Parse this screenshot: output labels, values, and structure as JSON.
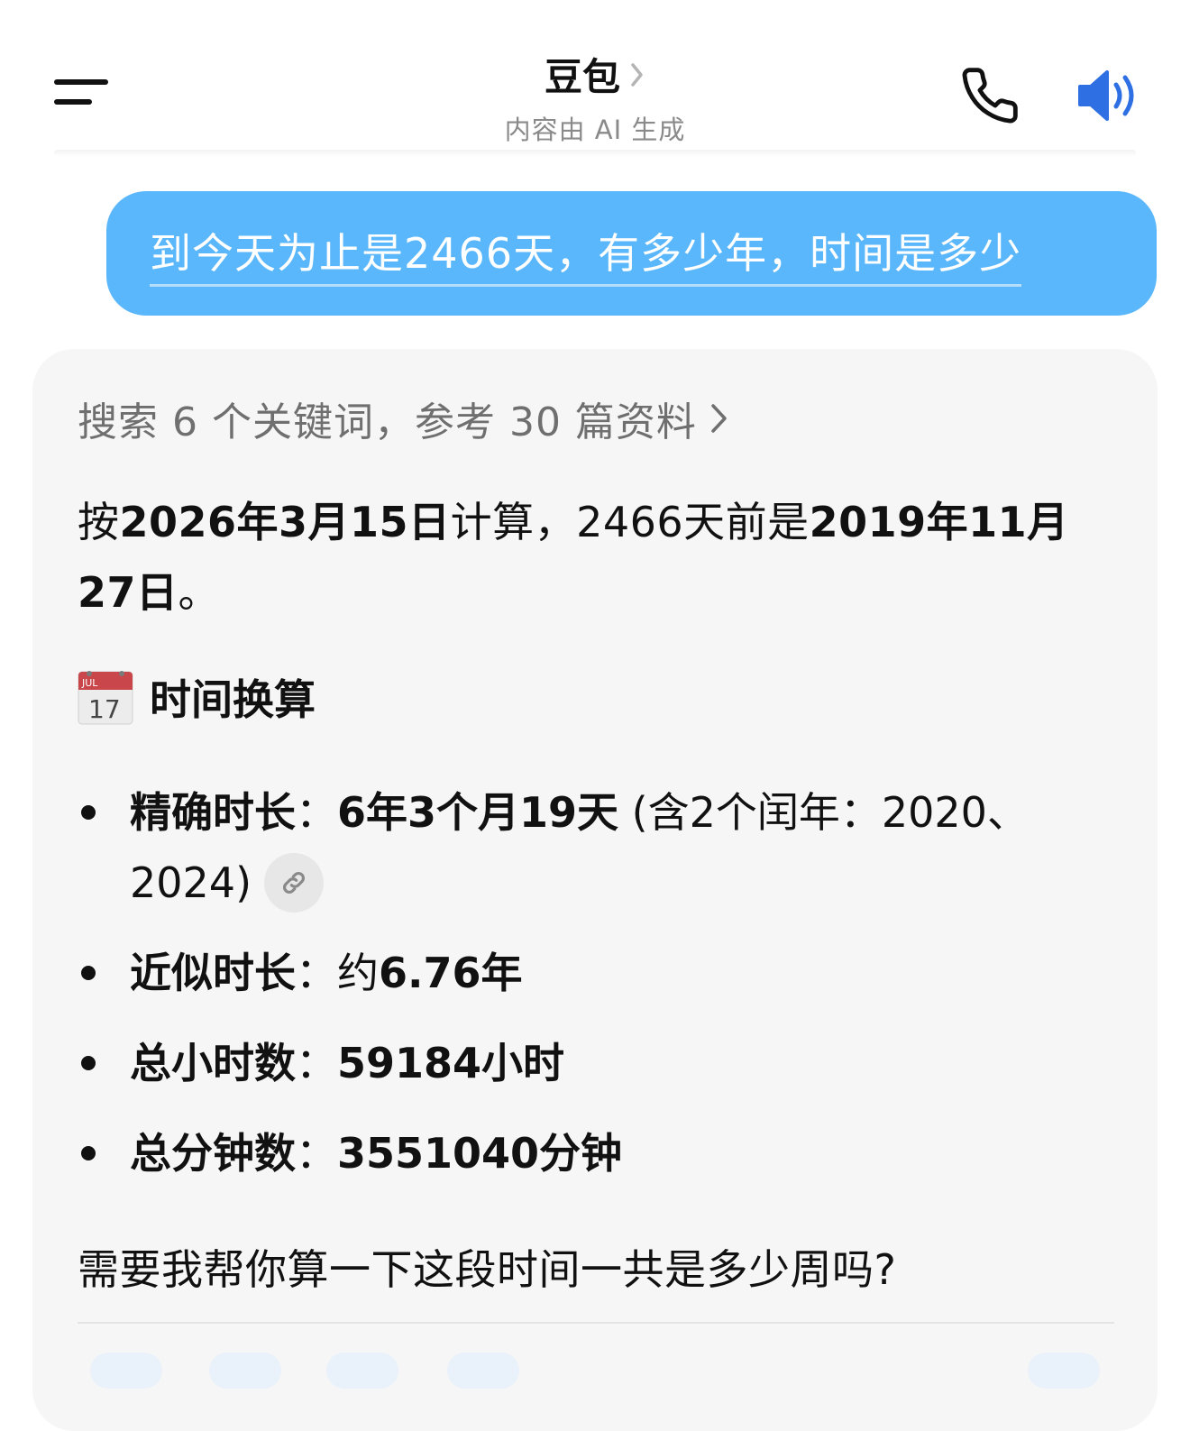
{
  "header": {
    "title": "豆包",
    "subtitle": "内容由 AI 生成"
  },
  "icons": {
    "menu": "menu-icon",
    "title_chevron": "chevron-right-icon",
    "phone": "phone-icon",
    "speaker": "speaker-icon",
    "calendar": "calendar-icon",
    "link": "link-icon"
  },
  "colors": {
    "user_bubble": "#5bb7fb",
    "speaker_icon": "#2f6fe4",
    "card_background": "#f6f6f6"
  },
  "user_message": "到今天为止是2466天，有多少年，时间是多少",
  "reply": {
    "search_summary": "搜索 6 个关键词，参考 30 篇资料",
    "p1": {
      "t1": "按",
      "t2": "2026年3月15日",
      "t3": "计算，2466天前是",
      "t4": "2019年11月27日",
      "t5": "。"
    },
    "section_title": "时间换算",
    "calendar_icon_month": "JUL",
    "calendar_icon_day": "17",
    "bullets": [
      {
        "label": "精确时长",
        "sep": "：",
        "value": "6年3个月19天",
        "extra": " (含2个闰年：2020、2024)"
      },
      {
        "label": "近似时长",
        "sep": "：",
        "pre": "约",
        "value": "6.76年"
      },
      {
        "label": "总小时数",
        "sep": "：",
        "value": "59184小时"
      },
      {
        "label": "总分钟数",
        "sep": "：",
        "value": "3551040分钟"
      }
    ],
    "followup": "需要我帮你算一下这段时间一共是多少周吗?"
  }
}
